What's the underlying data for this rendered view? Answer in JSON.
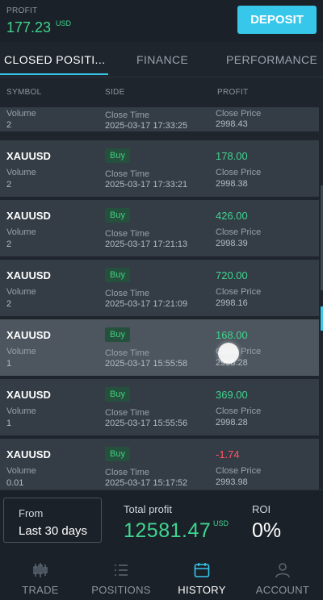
{
  "header": {
    "profit_label": "PROFIT",
    "profit_value": "177.23",
    "profit_unit": "USD",
    "deposit_label": "DEPOSIT"
  },
  "tabs": [
    {
      "label": "CLOSED POSITI...",
      "active": true
    },
    {
      "label": "FINANCE",
      "active": false
    },
    {
      "label": "PERFORMANCE",
      "active": false
    }
  ],
  "columns": {
    "symbol": "SYMBOL",
    "side": "SIDE",
    "profit": "PROFIT"
  },
  "row_labels": {
    "volume": "Volume",
    "close_time": "Close Time",
    "close_price": "Close Price"
  },
  "partial_row": {
    "volume": "2",
    "close_time": "2025-03-17 17:33:25",
    "close_price": "2998.43"
  },
  "rows": [
    {
      "symbol": "XAUUSD",
      "side": "Buy",
      "profit": "178.00",
      "volume": "2",
      "close_time": "2025-03-17 17:33:21",
      "close_price": "2998.38"
    },
    {
      "symbol": "XAUUSD",
      "side": "Buy",
      "profit": "426.00",
      "volume": "2",
      "close_time": "2025-03-17 17:21:13",
      "close_price": "2998.39"
    },
    {
      "symbol": "XAUUSD",
      "side": "Buy",
      "profit": "720.00",
      "volume": "2",
      "close_time": "2025-03-17 17:21:09",
      "close_price": "2998.16"
    },
    {
      "symbol": "XAUUSD",
      "side": "Buy",
      "profit": "168.00",
      "volume": "1",
      "close_time": "2025-03-17 15:55:58",
      "close_price": "2998.28"
    },
    {
      "symbol": "XAUUSD",
      "side": "Buy",
      "profit": "369.00",
      "volume": "1",
      "close_time": "2025-03-17 15:55:56",
      "close_price": "2998.28"
    },
    {
      "symbol": "XAUUSD",
      "side": "Buy",
      "profit": "-1.74",
      "volume": "0.01",
      "close_time": "2025-03-17 15:17:52",
      "close_price": "2993.98"
    }
  ],
  "summary": {
    "from_label": "From",
    "from_value": "Last 30 days",
    "total_label": "Total profit",
    "total_value": "12581.47",
    "total_unit": "USD",
    "roi_label": "ROI",
    "roi_value": "0%"
  },
  "nav": [
    {
      "label": "TRADE",
      "icon": "candlestick-icon",
      "active": false
    },
    {
      "label": "POSITIONS",
      "icon": "list-icon",
      "active": false
    },
    {
      "label": "HISTORY",
      "icon": "calendar-icon",
      "active": true
    },
    {
      "label": "ACCOUNT",
      "icon": "user-icon",
      "active": false
    }
  ],
  "colors": {
    "accent": "#37c7ea",
    "positive": "#3fd58f",
    "negative": "#ff5466",
    "badge_bg": "#26503e"
  }
}
